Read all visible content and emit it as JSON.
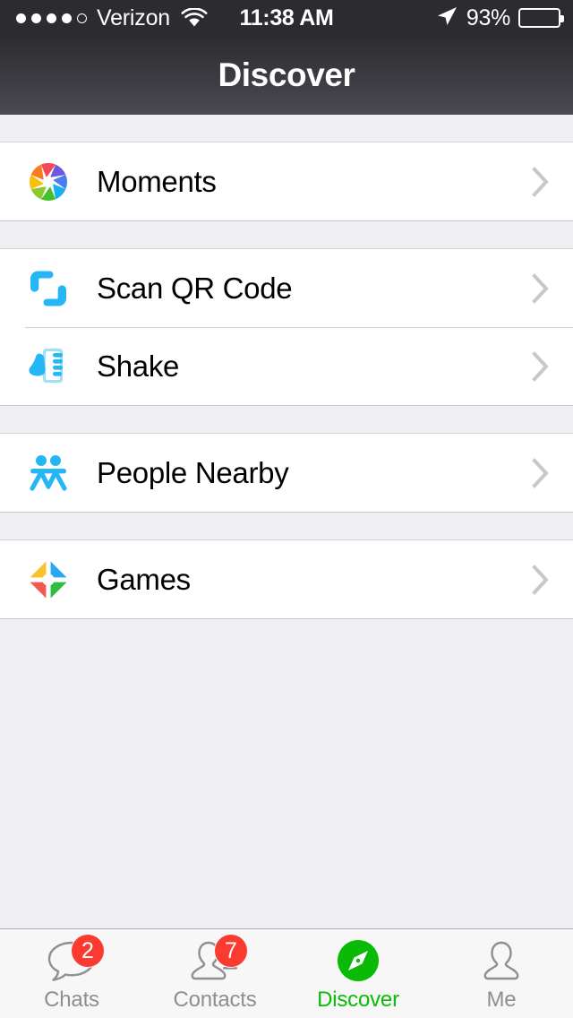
{
  "status_bar": {
    "carrier": "Verizon",
    "signal_dots_filled": 4,
    "signal_dots_total": 5,
    "wifi_icon": "wifi-icon",
    "time": "11:38 AM",
    "location_icon": "location-arrow-icon",
    "battery_percent": "93%",
    "battery_icon": "battery-icon",
    "battery_level": 93,
    "background_color": "#2B2B30"
  },
  "nav_bar": {
    "title": "Discover"
  },
  "list": {
    "groups": [
      {
        "rows": [
          {
            "icon": "moments-aperture-icon",
            "label": "Moments",
            "accessory": "chevron-right-icon"
          }
        ]
      },
      {
        "rows": [
          {
            "icon": "scan-qr-code-icon",
            "label": "Scan QR Code",
            "accessory": "chevron-right-icon"
          },
          {
            "icon": "shake-phone-icon",
            "label": "Shake",
            "accessory": "chevron-right-icon"
          }
        ]
      },
      {
        "rows": [
          {
            "icon": "people-nearby-icon",
            "label": "People Nearby",
            "accessory": "chevron-right-icon"
          }
        ]
      },
      {
        "rows": [
          {
            "icon": "games-pinwheel-icon",
            "label": "Games",
            "accessory": "chevron-right-icon"
          }
        ]
      }
    ]
  },
  "tab_bar": {
    "active_color": "#09BB07",
    "inactive_color": "#8E8E93",
    "badge_color": "#FB3B30",
    "tabs": [
      {
        "key": "chats",
        "label": "Chats",
        "icon": "chat-bubble-icon",
        "badge": "2",
        "active": false
      },
      {
        "key": "contacts",
        "label": "Contacts",
        "icon": "contacts-icon",
        "badge": "7",
        "active": false
      },
      {
        "key": "discover",
        "label": "Discover",
        "icon": "compass-icon",
        "badge": null,
        "active": true
      },
      {
        "key": "me",
        "label": "Me",
        "icon": "person-icon",
        "badge": null,
        "active": false
      }
    ]
  }
}
